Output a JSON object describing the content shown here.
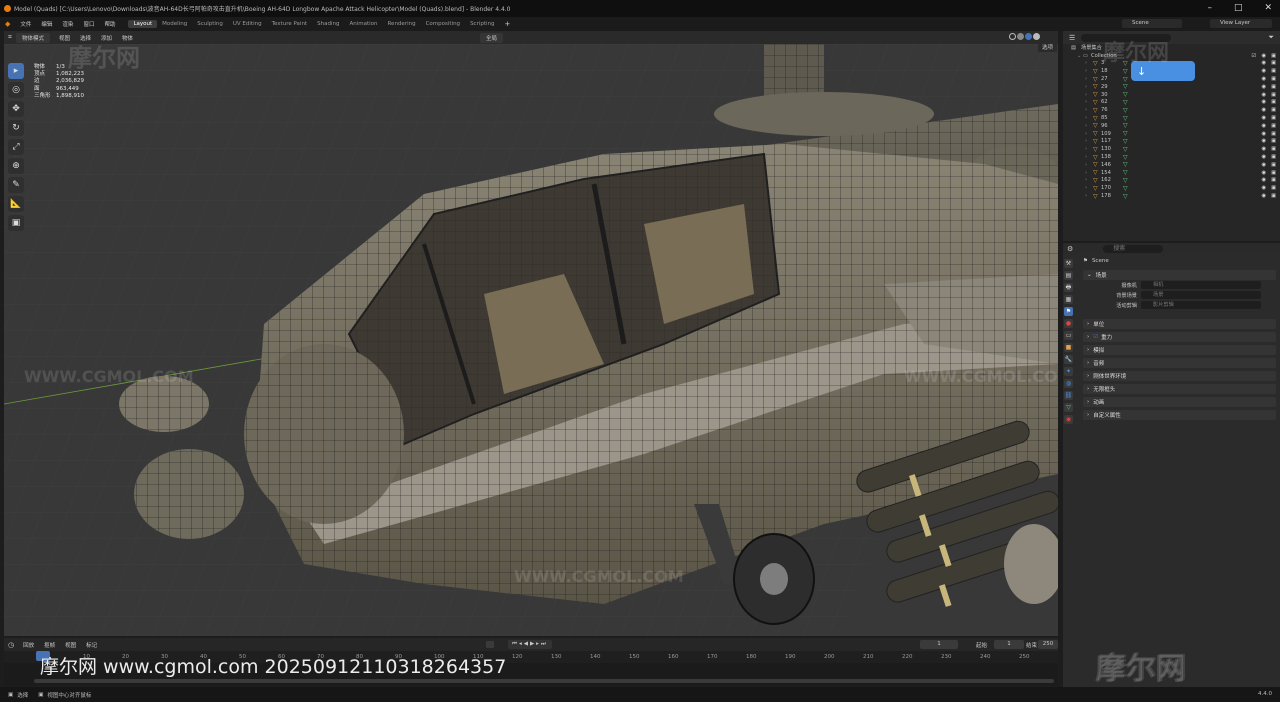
{
  "window": {
    "title": "Model (Quads) [C:\\Users\\Lenovo\\Downloads\\波音AH-64D长弓阿帕奇攻击直升机\\Boeing AH-64D Longbow Apache Attack Helicopter\\Model (Quads).blend] - Blender 4.4.0"
  },
  "menu": [
    "文件",
    "编辑",
    "渲染",
    "窗口",
    "帮助"
  ],
  "workspaces": [
    "Layout",
    "Modeling",
    "Sculpting",
    "UV Editing",
    "Texture Paint",
    "Shading",
    "Animation",
    "Rendering",
    "Compositing",
    "Scripting"
  ],
  "scene_name": "Scene",
  "view_layer": "View Layer",
  "viewport_header": {
    "mode": "物体模式",
    "items": [
      "视图",
      "选择",
      "添加",
      "物体"
    ],
    "transform": "全局",
    "options": "选项"
  },
  "stats": [
    {
      "label": "物体",
      "value": "1/3"
    },
    {
      "label": "顶点",
      "value": "1,082,223"
    },
    {
      "label": "边",
      "value": "2,036,829"
    },
    {
      "label": "面",
      "value": "963,449"
    },
    {
      "label": "三角形",
      "value": "1,898,910"
    }
  ],
  "outliner": {
    "title": "场景集合",
    "collection": "Collection",
    "rows": [
      "3",
      "18",
      "27",
      "29",
      "30",
      "62",
      "76",
      "85",
      "96",
      "109",
      "117",
      "130",
      "138",
      "146",
      "154",
      "162",
      "170",
      "178"
    ]
  },
  "properties": {
    "search_placeholder": "搜索",
    "scene": "Scene",
    "section_scene": "场景",
    "camera_label": "摄像机",
    "camera_value": "相机",
    "bg_label": "背景场景",
    "bg_value": "场景",
    "clip_label": "活动剪辑",
    "clip_value": "影片剪辑",
    "panels": [
      "单位",
      "重力",
      "模拟",
      "音频",
      "刚体世界环境",
      "无限框头",
      "动画",
      "自定义属性"
    ]
  },
  "timeline": {
    "menu": [
      "回放",
      "抠帧",
      "视图",
      "标记"
    ],
    "current_frame": "1",
    "start_label": "起始",
    "start": "1",
    "end_label": "结束",
    "end": "250",
    "ticks": [
      "0",
      "10",
      "20",
      "30",
      "40",
      "50",
      "60",
      "70",
      "80",
      "90",
      "100",
      "110",
      "120",
      "130",
      "140",
      "150",
      "160",
      "170",
      "180",
      "190",
      "200",
      "210",
      "220",
      "230",
      "240",
      "250"
    ]
  },
  "status": {
    "select": "选择",
    "center": "视图中心对齐鼠标",
    "version": "4.4.0"
  },
  "watermarks": {
    "main": "摩尔网 www.cgmol.com 20250912110318264357",
    "logo": "摩尔网",
    "url": "WWW.CGMOL.COM"
  },
  "colors": {
    "accent": "#4772b3",
    "mesh_orange": "#e3a14b",
    "mesh_green": "#6ad08d"
  }
}
